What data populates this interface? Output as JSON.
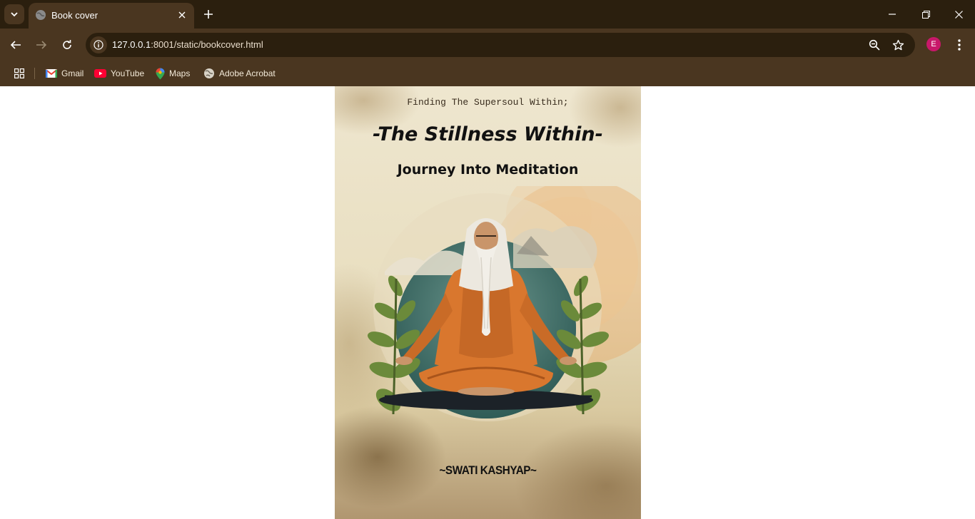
{
  "browser": {
    "tab": {
      "title": "Book cover"
    },
    "address_bar": {
      "host": "127.0.0.1",
      "rest": ":8001/static/bookcover.html"
    },
    "profile_initial": "E",
    "bookmarks": [
      {
        "label": "Gmail",
        "icon": "gmail-icon"
      },
      {
        "label": "YouTube",
        "icon": "youtube-icon"
      },
      {
        "label": "Maps",
        "icon": "maps-icon"
      },
      {
        "label": "Adobe Acrobat",
        "icon": "globe-icon"
      }
    ]
  },
  "cover": {
    "tagline": "Finding The Supersoul Within;",
    "title": "-The Stillness Within-",
    "subtitle": "Journey Into Meditation",
    "author": "~SWATI KASHYAP~",
    "illustration": "meditating-sage-illustration"
  },
  "colors": {
    "chrome_dark": "#2b1f0e",
    "chrome_toolbar": "#4a3620",
    "robe": "#d9772e",
    "avatar": "#c8186a"
  }
}
